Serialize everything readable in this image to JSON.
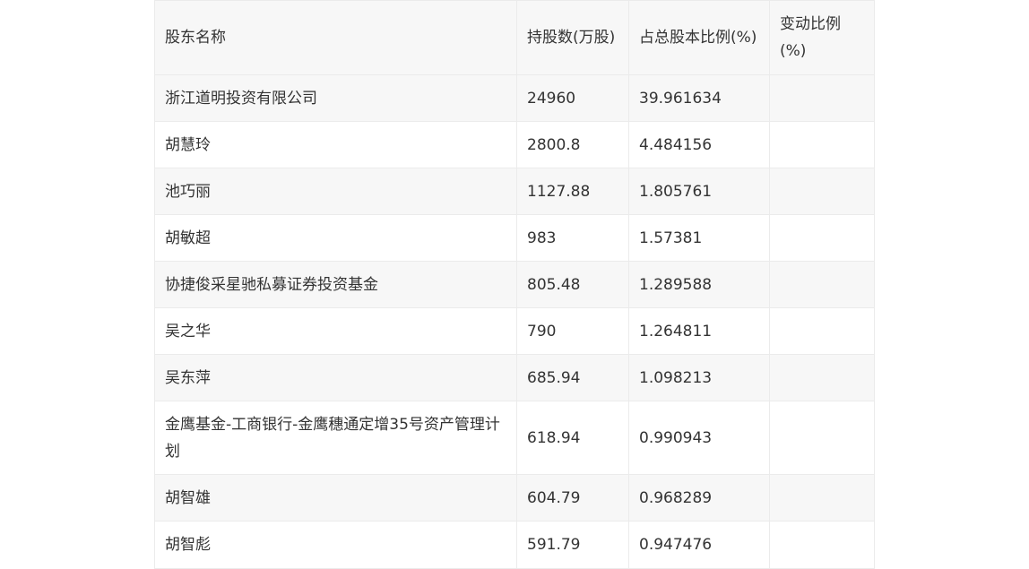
{
  "table": {
    "headers": [
      "股东名称",
      "持股数(万股)",
      "占总股本比例(%)",
      "变动比例(%)"
    ],
    "rows": [
      [
        "浙江道明投资有限公司",
        "24960",
        "39.961634",
        ""
      ],
      [
        "胡慧玲",
        "2800.8",
        "4.484156",
        ""
      ],
      [
        "池巧丽",
        "1127.88",
        "1.805761",
        ""
      ],
      [
        "胡敏超",
        "983",
        "1.57381",
        ""
      ],
      [
        "协捷俊采星驰私募证券投资基金",
        "805.48",
        "1.289588",
        ""
      ],
      [
        "吴之华",
        "790",
        "1.264811",
        ""
      ],
      [
        "吴东萍",
        "685.94",
        "1.098213",
        ""
      ],
      [
        "金鹰基金-工商银行-金鹰穗通定增35号资产管理计划",
        "618.94",
        "0.990943",
        ""
      ],
      [
        "胡智雄",
        "604.79",
        "0.968289",
        ""
      ],
      [
        "胡智彪",
        "591.79",
        "0.947476",
        ""
      ]
    ]
  }
}
